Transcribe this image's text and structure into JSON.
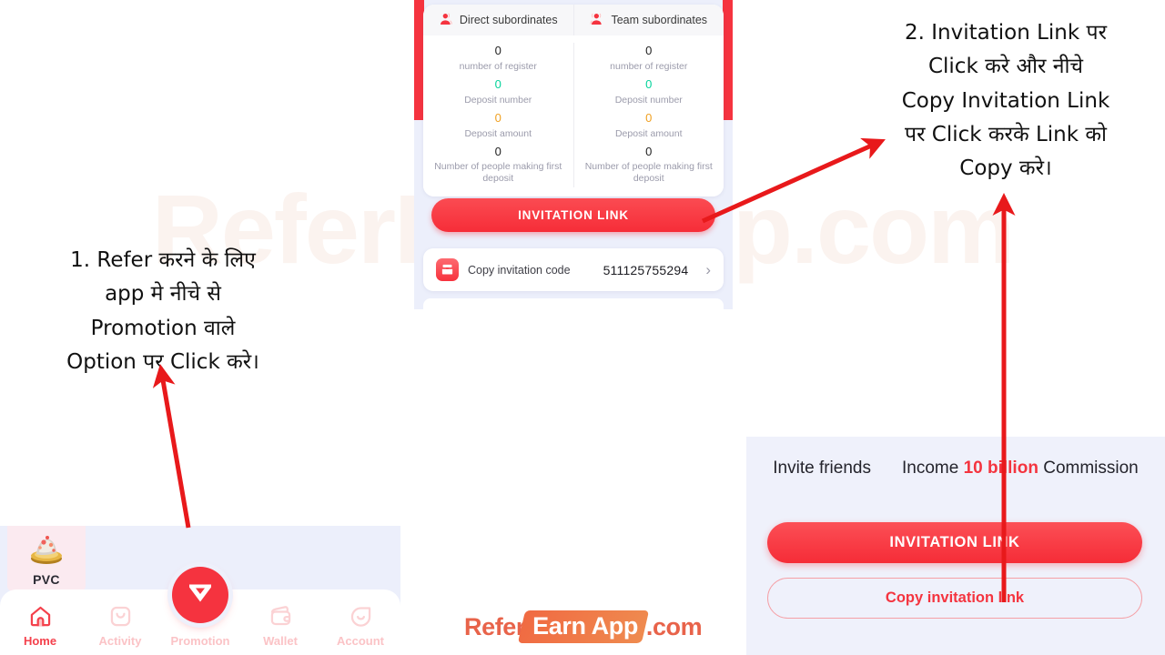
{
  "watermark": "ReferEarnApp.com",
  "stats_card": {
    "columns": [
      {
        "icon": "person-icon",
        "title": "Direct subordinates",
        "rows": [
          {
            "value": "0",
            "label": "number of register",
            "color": "default"
          },
          {
            "value": "0",
            "label": "Deposit number",
            "color": "green"
          },
          {
            "value": "0",
            "label": "Deposit amount",
            "color": "orange"
          },
          {
            "value": "0",
            "label": "Number of people making first deposit",
            "color": "default"
          }
        ]
      },
      {
        "icon": "person-icon",
        "title": "Team subordinates",
        "rows": [
          {
            "value": "0",
            "label": "number of register",
            "color": "default"
          },
          {
            "value": "0",
            "label": "Deposit number",
            "color": "green"
          },
          {
            "value": "0",
            "label": "Deposit amount",
            "color": "orange"
          },
          {
            "value": "0",
            "label": "Number of people making first deposit",
            "color": "default"
          }
        ]
      }
    ]
  },
  "app_panel": {
    "invitation_link_button": "INVITATION LINK",
    "copy_code": {
      "icon": "invitation-code-icon",
      "label": "Copy invitation code",
      "value": "511125755294",
      "chevron": "chevron-right-icon"
    }
  },
  "bottom_nav": {
    "pvc_badge": {
      "icon": "treasure-icon",
      "label": "PVC"
    },
    "center_button": {
      "icon": "diamond-icon"
    },
    "items": [
      {
        "icon": "home-icon",
        "label": "Home",
        "active": true
      },
      {
        "icon": "activity-icon",
        "label": "Activity",
        "active": false
      },
      {
        "icon": "promotion-icon",
        "label": "Promotion",
        "active": false
      },
      {
        "icon": "wallet-icon",
        "label": "Wallet",
        "active": false
      },
      {
        "icon": "account-icon",
        "label": "Account",
        "active": false
      }
    ]
  },
  "invite_panel": {
    "heading_left": "Invite friends",
    "heading_right_pre": "Income ",
    "heading_right_highlight": "10 billion",
    "heading_right_post": " Commission",
    "invitation_link_button": "INVITATION LINK",
    "copy_link_button": "Copy invitation link"
  },
  "annotations": [
    {
      "id": "annotation-1",
      "lines": [
        "1. Refer करने के लिए",
        "app मे नीचे से",
        "Promotion वाले",
        "Option पर Click करे।"
      ]
    },
    {
      "id": "annotation-2",
      "lines": [
        "2. Invitation Link पर",
        "Click करे और नीचे",
        "Copy Invitation Link",
        "पर Click करके Link को",
        "Copy करे।"
      ]
    }
  ],
  "logo": {
    "part1": "Refer",
    "part2": "Earn App",
    "part3": ".com"
  },
  "colors": {
    "brand_red": "#f5333f",
    "accent_green": "#05d39b",
    "accent_orange": "#f0a021",
    "panel_bg": "#eceffb",
    "arrow_red": "#e8191b"
  }
}
